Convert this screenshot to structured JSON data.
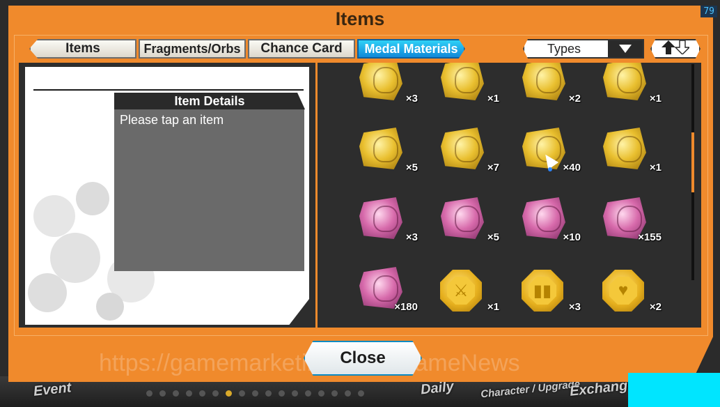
{
  "window": {
    "title": "Items",
    "fps_counter": "79"
  },
  "tabs": [
    {
      "label": "Items",
      "active": false
    },
    {
      "label": "Fragments/Orbs",
      "active": false
    },
    {
      "label": "Chance Card",
      "active": false
    },
    {
      "label": "Medal Materials",
      "active": true
    }
  ],
  "sort": {
    "types_label": "Types",
    "dropdown_icon": "triangle-down-icon",
    "order_icon": "up-down-arrows-icon"
  },
  "details": {
    "header": "Item Details",
    "prompt": "Please tap an item"
  },
  "items": [
    {
      "kind": "gold-medal",
      "qty": "×3"
    },
    {
      "kind": "gold-medal",
      "qty": "×1"
    },
    {
      "kind": "gold-medal",
      "qty": "×2"
    },
    {
      "kind": "gold-medal",
      "qty": "×1"
    },
    {
      "kind": "gold-medal",
      "qty": "×5"
    },
    {
      "kind": "gold-medal",
      "qty": "×7"
    },
    {
      "kind": "gold-medal",
      "qty": "×40"
    },
    {
      "kind": "gold-medal",
      "qty": "×1"
    },
    {
      "kind": "pink-medal",
      "qty": "×3"
    },
    {
      "kind": "pink-medal",
      "qty": "×5"
    },
    {
      "kind": "pink-medal",
      "qty": "×10"
    },
    {
      "kind": "pink-medal",
      "qty": "×155"
    },
    {
      "kind": "pink-medal",
      "qty": "×180"
    },
    {
      "kind": "sword-token",
      "qty": "×1"
    },
    {
      "kind": "armor-token",
      "qty": "×3"
    },
    {
      "kind": "heart-token",
      "qty": "×2"
    }
  ],
  "close_label": "Close",
  "watermark": "https://gamemarketingseller/GameNews",
  "background": {
    "event_label": "Event",
    "daily_label": "Daily",
    "character_label": "Character / Upgrade",
    "exchange_label": "Exchange"
  },
  "colors": {
    "frame": "#f08a2c",
    "active_tab": "#1ea6e6"
  }
}
